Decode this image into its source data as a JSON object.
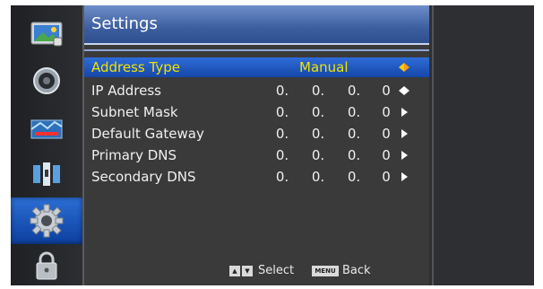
{
  "header": {
    "title": "Settings"
  },
  "sidebar": {
    "items": [
      {
        "icon": "picture-icon"
      },
      {
        "icon": "sound-icon"
      },
      {
        "icon": "channel-icon"
      },
      {
        "icon": "network-icon"
      },
      {
        "icon": "settings-gear-icon",
        "active": true
      },
      {
        "icon": "lock-icon"
      }
    ]
  },
  "settings": {
    "rows": [
      {
        "label": "Address Type",
        "value": "Manual",
        "selected": true
      },
      {
        "label": "IP Address",
        "octets": [
          "0.",
          "0.",
          "0.",
          "0"
        ]
      },
      {
        "label": "Subnet Mask",
        "octets": [
          "0.",
          "0.",
          "0.",
          "0"
        ]
      },
      {
        "label": "Default Gateway",
        "octets": [
          "0.",
          "0.",
          "0.",
          "0"
        ]
      },
      {
        "label": "Primary DNS",
        "octets": [
          "0.",
          "0.",
          "0.",
          "0"
        ]
      },
      {
        "label": "Secondary DNS",
        "octets": [
          "0.",
          "0.",
          "0.",
          "0"
        ]
      }
    ]
  },
  "footer": {
    "select_label": "Select",
    "menu_key": "MENU",
    "back_label": "Back"
  },
  "colors": {
    "selected_text": "#f2e200",
    "selected_bg": "#1f5cc8",
    "title_bg": "#4a6fb3"
  }
}
